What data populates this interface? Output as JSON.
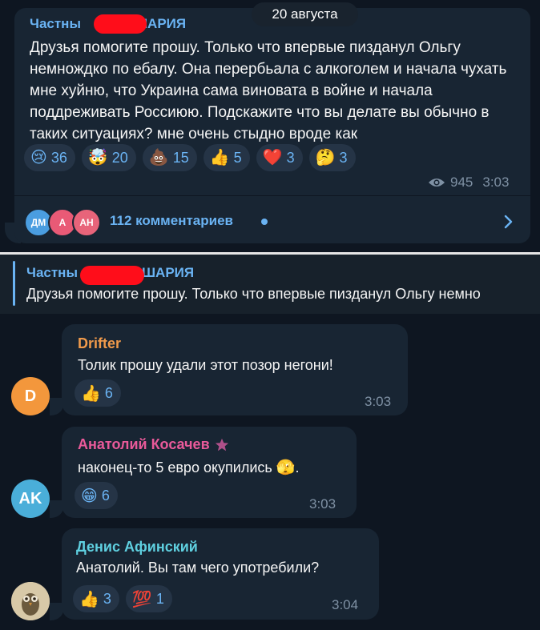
{
  "post": {
    "channel_prefix": "Частны",
    "channel_suffix": "ШАРИЯ",
    "date": "20 августа",
    "text": "Друзья помогите прошу. Только что впервые пизданул Ольгу немнождко по ебалу. Она перербьала с алкоголем и начала чухать мне хуйню, что Украина сама виновата в войне и начала поддреживать Россиюю. Подскажите что вы делате вы обычно в таких ситуациях? мне очень стыдно вроде как",
    "reactions": [
      {
        "emoji": "😢",
        "count": "36"
      },
      {
        "emoji": "🤯",
        "count": "20"
      },
      {
        "emoji": "💩",
        "count": "15"
      },
      {
        "emoji": "👍",
        "count": "5"
      },
      {
        "emoji": "❤️",
        "count": "3"
      },
      {
        "emoji": "🤔",
        "count": "3"
      }
    ],
    "views": "945",
    "time": "3:03",
    "commenter_avatars": [
      {
        "initials": "ДМ",
        "color": "#4a9de0"
      },
      {
        "initials": "А",
        "color": "#e95a76"
      },
      {
        "initials": "АН",
        "color": "#e8647a"
      }
    ],
    "comments_label": "112 комментариев"
  },
  "pinned": {
    "channel_prefix": "Частны",
    "channel_suffix": "ШАРИЯ",
    "text": "Друзья помогите прошу. Только что впервые пизданул Ольгу немно"
  },
  "comments": [
    {
      "name": "Drifter",
      "name_color": "#f09a4b",
      "text": "Толик прошу удали этот позор негони!",
      "avatar_initials": "D",
      "avatar_color": "#f3973c",
      "reaction_emoji": "👍",
      "reaction_count": "6",
      "time": "3:03"
    },
    {
      "name": "Анатолий Косачев",
      "name_color": "#e95a9a",
      "text": "наконец-то 5 евро окупились",
      "text_emoji": "🫣",
      "avatar_initials": "AK",
      "avatar_color": "#4aaed9",
      "reaction_emoji": "😁",
      "reaction_count": "6",
      "time": "3:03"
    },
    {
      "name": "Денис Афинский",
      "name_color": "#5fd0e0",
      "text": "Анатолий. Вы там чего употребили?",
      "avatar_icon": "owl-icon",
      "reactions": [
        {
          "emoji": "👍",
          "count": "3"
        },
        {
          "emoji": "💯",
          "count": "1"
        }
      ],
      "time": "3:04"
    }
  ]
}
